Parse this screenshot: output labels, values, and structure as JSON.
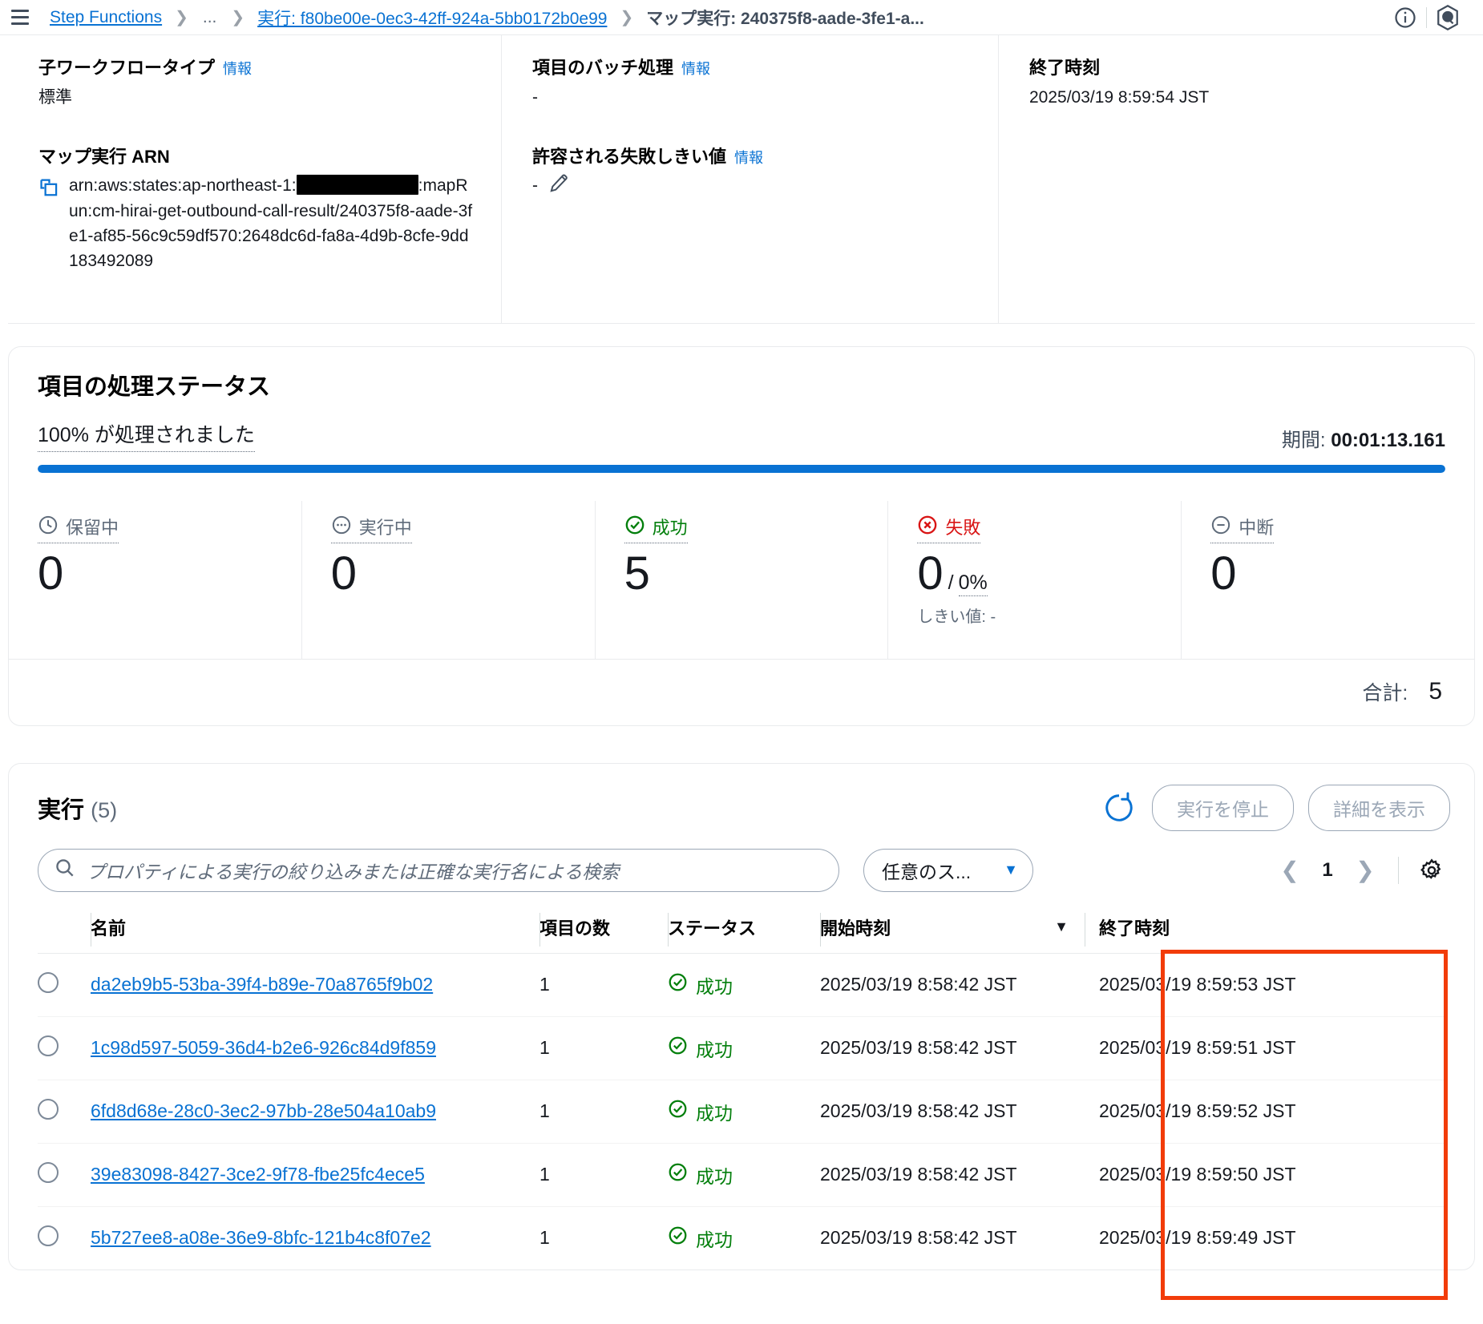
{
  "breadcrumb": {
    "root": "Step Functions",
    "ellipsis": "...",
    "execution": "実行: f80be00e-0ec3-42ff-924a-5bb0172b0e99",
    "current": "マップ実行: 240375f8-aade-3fe1-a...",
    "separator": "❯"
  },
  "topbar": {
    "menu_icon": "hamburger-icon",
    "info_icon": "info-circle-icon",
    "assistant_icon": "aws-q-hexagon-icon"
  },
  "overview": {
    "child_workflow_type": {
      "label": "子ワークフロータイプ",
      "info": "情報",
      "value": "標準"
    },
    "map_run_arn": {
      "label": "マップ実行 ARN",
      "value_part1": "arn:aws:states:ap-northeast-1:",
      "redacted": "",
      "value_part2": ":mapRun:cm-hirai-get-outbound-call-result/240375f8-aade-3fe1-af85-56c9c59df570:2648dc6d-fa8a-4d9b-8cfe-9dd183492089",
      "copy_icon": "copy-icon"
    },
    "item_batching": {
      "label": "項目のバッチ処理",
      "info": "情報",
      "value": "-"
    },
    "tolerated_failure": {
      "label": "許容される失敗しきい値",
      "info": "情報",
      "value": "-",
      "edit_icon": "pencil-icon"
    },
    "end_time": {
      "label": "終了時刻",
      "value": "2025/03/19 8:59:54 JST"
    }
  },
  "status": {
    "title": "項目の処理ステータス",
    "percent_text": "100% が処理されました",
    "percent_value": 100,
    "duration_label": "期間:",
    "duration_value": "00:01:13.161",
    "progress_color": "#0972d3",
    "stats": [
      {
        "label": "保留中",
        "icon": "clock-icon",
        "value": "0",
        "tone": "neutral"
      },
      {
        "label": "実行中",
        "icon": "dots-circle-icon",
        "value": "0",
        "tone": "neutral"
      },
      {
        "label": "成功",
        "icon": "check-circle-icon",
        "value": "5",
        "tone": "success"
      },
      {
        "label": "失敗",
        "icon": "error-circle-icon",
        "value": "0",
        "tone": "error",
        "fraction": "0%",
        "note": "しきい値: -"
      },
      {
        "label": "中断",
        "icon": "minus-circle-icon",
        "value": "0",
        "tone": "neutral"
      }
    ],
    "total_label": "合計:",
    "total_value": "5",
    "success_color": "#037f0c",
    "error_color": "#d91515"
  },
  "executions": {
    "title": "実行",
    "count": "(5)",
    "refresh_icon": "refresh-icon",
    "stop_button": "実行を停止",
    "details_button": "詳細を表示",
    "search": {
      "placeholder": "プロパティによる実行の絞り込みまたは正確な実行名による検索",
      "value": "",
      "icon": "search-icon"
    },
    "status_filter": {
      "selected": "任意のス...",
      "caret": "▼"
    },
    "pagination": {
      "prev": "❮",
      "page": "1",
      "next": "❯",
      "settings_icon": "gear-icon"
    },
    "columns": [
      {
        "key": "select",
        "label": ""
      },
      {
        "key": "name",
        "label": "名前"
      },
      {
        "key": "items",
        "label": "項目の数"
      },
      {
        "key": "status",
        "label": "ステータス"
      },
      {
        "key": "start",
        "label": "開始時刻",
        "sorted": "▼"
      },
      {
        "key": "end",
        "label": "終了時刻"
      }
    ],
    "rows": [
      {
        "name": "da2eb9b5-53ba-39f4-b89e-70a8765f9b02",
        "items": "1",
        "status": "成功",
        "start": "2025/03/19 8:58:42 JST",
        "end": "2025/03/19 8:59:53 JST"
      },
      {
        "name": "1c98d597-5059-36d4-b2e6-926c84d9f859",
        "items": "1",
        "status": "成功",
        "start": "2025/03/19 8:58:42 JST",
        "end": "2025/03/19 8:59:51 JST"
      },
      {
        "name": "6fd8d68e-28c0-3ec2-97bb-28e504a10ab9",
        "items": "1",
        "status": "成功",
        "start": "2025/03/19 8:58:42 JST",
        "end": "2025/03/19 8:59:52 JST"
      },
      {
        "name": "39e83098-8427-3ce2-9f78-fbe25fc4ece5",
        "items": "1",
        "status": "成功",
        "start": "2025/03/19 8:58:42 JST",
        "end": "2025/03/19 8:59:50 JST"
      },
      {
        "name": "5b727ee8-a08e-36e9-8bfc-121b4c8f07e2",
        "items": "1",
        "status": "成功",
        "start": "2025/03/19 8:58:42 JST",
        "end": "2025/03/19 8:59:49 JST"
      }
    ],
    "highlight_color": "#f23c0a"
  }
}
